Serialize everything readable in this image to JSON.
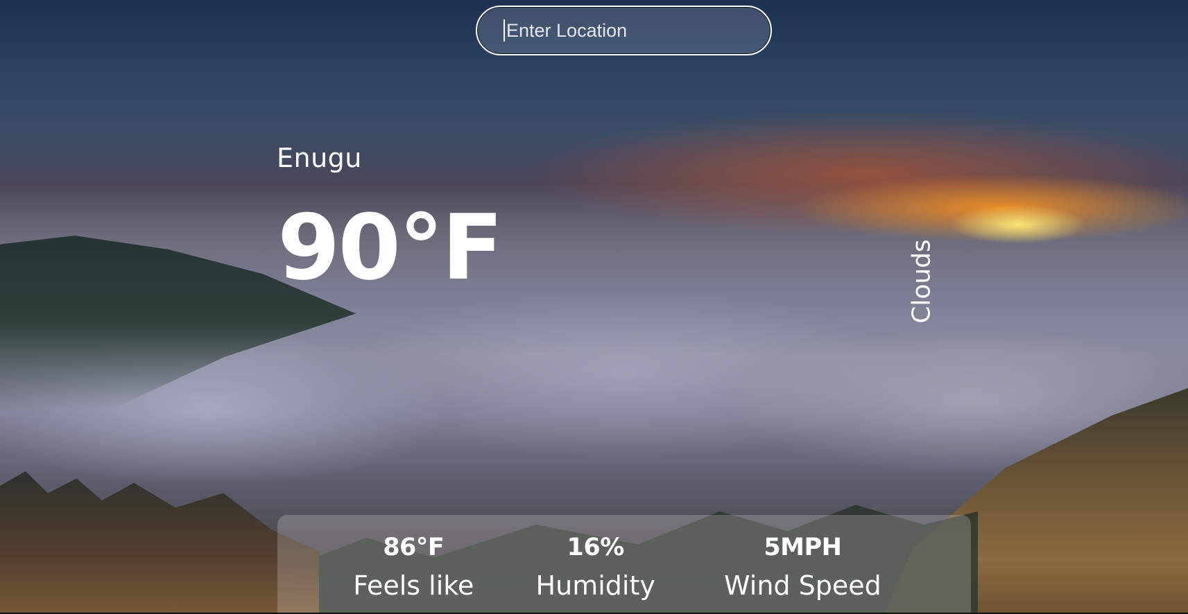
{
  "search": {
    "placeholder": "Enter Location",
    "value": ""
  },
  "weather": {
    "location": "Enugu",
    "temperature": "90°F",
    "description": "Clouds"
  },
  "stats": {
    "feels_like": {
      "value": "86°F",
      "label": "Feels like"
    },
    "humidity": {
      "value": "16%",
      "label": "Humidity"
    },
    "wind_speed": {
      "value": "5MPH",
      "label": "Wind Speed"
    }
  }
}
